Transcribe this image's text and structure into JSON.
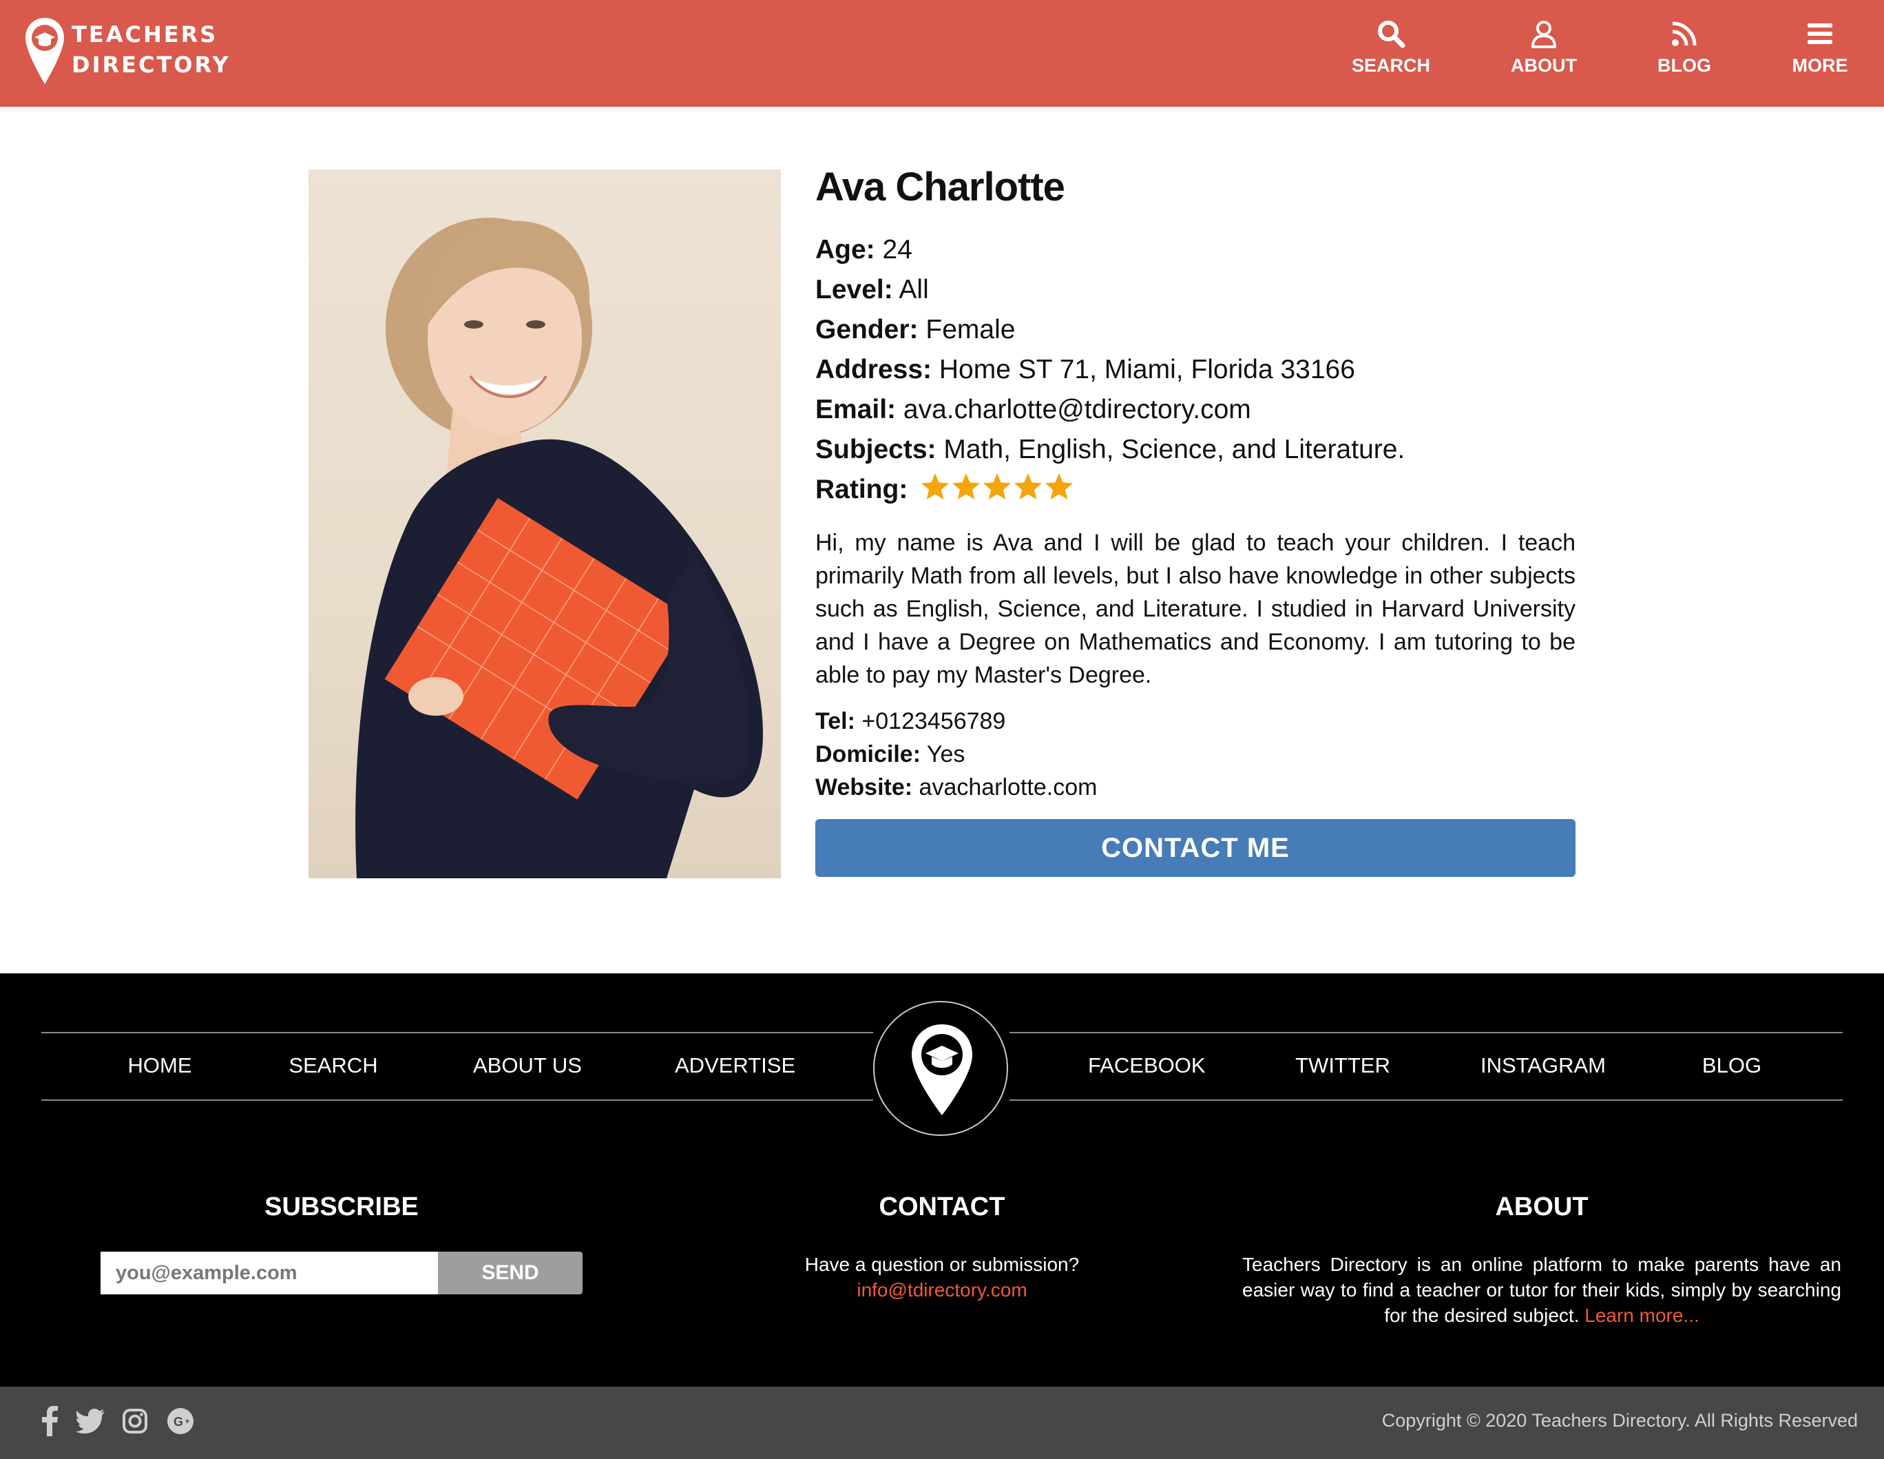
{
  "header": {
    "logo_line1": "TEACHERS",
    "logo_line2": "DIRECTORY",
    "nav": [
      {
        "label": "SEARCH",
        "icon": "search-icon"
      },
      {
        "label": "ABOUT",
        "icon": "user-icon"
      },
      {
        "label": "BLOG",
        "icon": "rss-icon"
      },
      {
        "label": "MORE",
        "icon": "menu-icon"
      }
    ],
    "background": "#d9594c"
  },
  "profile": {
    "name": "Ava Charlotte",
    "fields": [
      {
        "label": "Age:",
        "value": "24"
      },
      {
        "label": "Level:",
        "value": "All"
      },
      {
        "label": "Gender:",
        "value": "Female"
      },
      {
        "label": "Address:",
        "value": "Home ST 71, Miami, Florida 33166"
      },
      {
        "label": "Email:",
        "value": "ava.charlotte@tdirectory.com"
      },
      {
        "label": "Subjects:",
        "value": "Math, English, Science, and Literature."
      }
    ],
    "rating_label": "Rating:",
    "rating": 5,
    "rating_max": 5,
    "star_color": "#f5a40c",
    "bio": "Hi, my name is Ava and I will be glad to teach your children. I teach primarily Math from all levels, but I also have knowledge in other subjects such as English, Science, and Literature. I studied in Harvard University and I have a Degree on Mathematics and Economy. I am tutoring to be able to pay my Master's Degree.",
    "details": [
      {
        "label": "Tel:",
        "value": "+0123456789"
      },
      {
        "label": "Domicile:",
        "value": "Yes"
      },
      {
        "label": "Website:",
        "value": "avacharlotte.com"
      }
    ],
    "contact_button": "CONTACT ME",
    "contact_button_color": "#467cb7"
  },
  "footer": {
    "nav_left": [
      "HOME",
      "SEARCH",
      "ABOUT US",
      "ADVERTISE"
    ],
    "nav_right": [
      "FACEBOOK",
      "TWITTER",
      "INSTAGRAM",
      "BLOG"
    ],
    "subscribe": {
      "title": "SUBSCRIBE",
      "placeholder": "you@example.com",
      "button": "SEND"
    },
    "contact": {
      "title": "CONTACT",
      "line1": "Have a question or submission?",
      "email": "info@tdirectory.com"
    },
    "about": {
      "title": "ABOUT",
      "text": "Teachers Directory is an online platform to make parents have an easier way to find a teacher or tutor for their kids, simply by searching for the desired subject. ",
      "link": "Learn more..."
    },
    "link_color": "#f05a3a"
  },
  "bottom_bar": {
    "social_icons": [
      "facebook-icon",
      "twitter-icon",
      "instagram-icon",
      "google-plus-icon"
    ],
    "copyright": "Copyright © 2020 Teachers Directory. All Rights Reserved"
  }
}
